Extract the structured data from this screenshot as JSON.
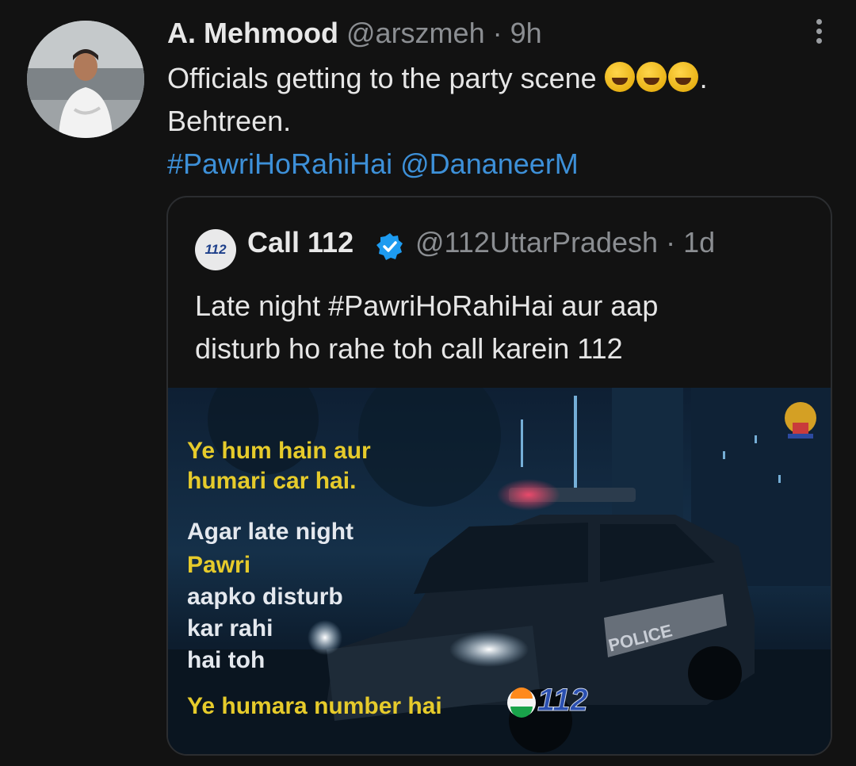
{
  "tweet": {
    "name": "A. Mehmood",
    "handle": "@arszmeh",
    "separator": "·",
    "time": "9h",
    "text_line1": "Officials getting to the party scene",
    "text_line1_end": ".",
    "text_line2": "Behtreen.",
    "hashtag": "#PawriHoRahiHai",
    "mention": "@DananeerM",
    "emojis": [
      "rolling-on-floor-laughing",
      "tears-of-joy",
      "rolling-on-floor-laughing"
    ]
  },
  "quoted": {
    "logo_text": "112",
    "name": "Call 112",
    "handle": "@112UttarPradesh",
    "separator": "·",
    "time": "1d",
    "text_line1": "Late night #PawriHoRahiHai aur aap",
    "text_line2": "disturb ho rahe toh call karein 112",
    "media": {
      "line1": "Ye hum hain aur",
      "line2": "humari car hai.",
      "line3": "Agar late night",
      "line4": "Pawri",
      "line5": "aapko disturb",
      "line6": "kar rahi",
      "line7": "hai toh",
      "line8": "Ye humara number hai",
      "number_logo": "112",
      "car_label": "POLICE"
    }
  },
  "colors": {
    "background": "#121212",
    "link": "#3d90d8",
    "muted": "#8b8e92",
    "verified": "#1d9bf0",
    "poster_yellow": "#e6cb2b"
  }
}
